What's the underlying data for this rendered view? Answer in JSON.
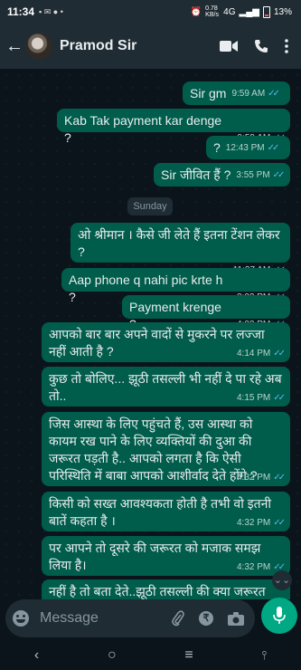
{
  "status": {
    "time": "11:34",
    "speed": "0.78\nKB/s",
    "net": "4G",
    "battery": "13%"
  },
  "header": {
    "contact_name": "Pramod Sir"
  },
  "date_divider": "Sunday",
  "messages": [
    {
      "text": "Sir gm",
      "time": "9:59 AM"
    },
    {
      "text": "Kab Tak payment kar denge ?",
      "time": "9:59 AM"
    },
    {
      "text": "?",
      "time": "12:43 PM"
    },
    {
      "text": "Sir जीवित हैं ?",
      "time": "3:55 PM"
    },
    {
      "text": "ओ श्रीमान । कैसे जी लेते हैं इतना टेंशन लेकर ?",
      "time": "11:37 AM"
    },
    {
      "text": "Aap phone q nahi pic krte h ?",
      "time": "3:02 PM"
    },
    {
      "text": "Payment krenge ?",
      "time": "4:03 PM"
    },
    {
      "text": "आपको बार बार अपने वादों से मुकरने पर लज्जा नहीं आती है ?",
      "time": "4:14 PM"
    },
    {
      "text": "कुछ तो बोलिए... झूठी तसल्ली भी नहीं दे पा रहे अब तो..",
      "time": "4:15 PM"
    },
    {
      "text": "जिस आस्था के लिए पहुंचते हैं, उस आस्था को कायम रख पाने के लिए व्यक्तियों की दुआ की जरूरत पड़ती है.. आपको लगता है कि ऐसी परिस्थिति में बाबा आपको आशीर्वाद देते होंगे ?",
      "time": "4:32 PM"
    },
    {
      "text": "किसी को सख्त आवश्यकता होती है तभी वो इतनी बातें कहता है ।",
      "time": "4:32 PM"
    },
    {
      "text": "पर आपने तो दूसरे की जरूरत को मजाक समझ लिया है।",
      "time": "4:32 PM"
    },
    {
      "text": "नहीं है तो बता देते..झूठी तसल्ली की क्या जरूरत",
      "time": ""
    }
  ],
  "composer": {
    "placeholder": "Message"
  }
}
